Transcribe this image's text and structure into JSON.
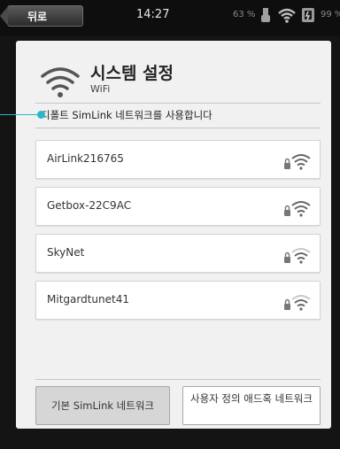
{
  "status_bar": {
    "back_label": "뒤로",
    "time": "14:27",
    "battery_left": "63 %",
    "battery_right": "99 %"
  },
  "header": {
    "title": "시스템 설정",
    "subtitle": "WiFi"
  },
  "default_network_text": "디폴트 SimLink 네트워크를 사용합니다",
  "networks": [
    {
      "name": "AirLink216765",
      "locked": true
    },
    {
      "name": "Getbox-22C9AC",
      "locked": true
    },
    {
      "name": "SkyNet",
      "locked": true
    },
    {
      "name": "Mitgardtunet41",
      "locked": true
    }
  ],
  "buttons": {
    "default_network": "기본 SimLink 네트워크",
    "adhoc_network": "사용자 정의 애드혹 네트워크"
  },
  "colors": {
    "accent": "#2bb7c9",
    "panel_bg": "#f1f1f1",
    "frame_bg": "#141414"
  }
}
